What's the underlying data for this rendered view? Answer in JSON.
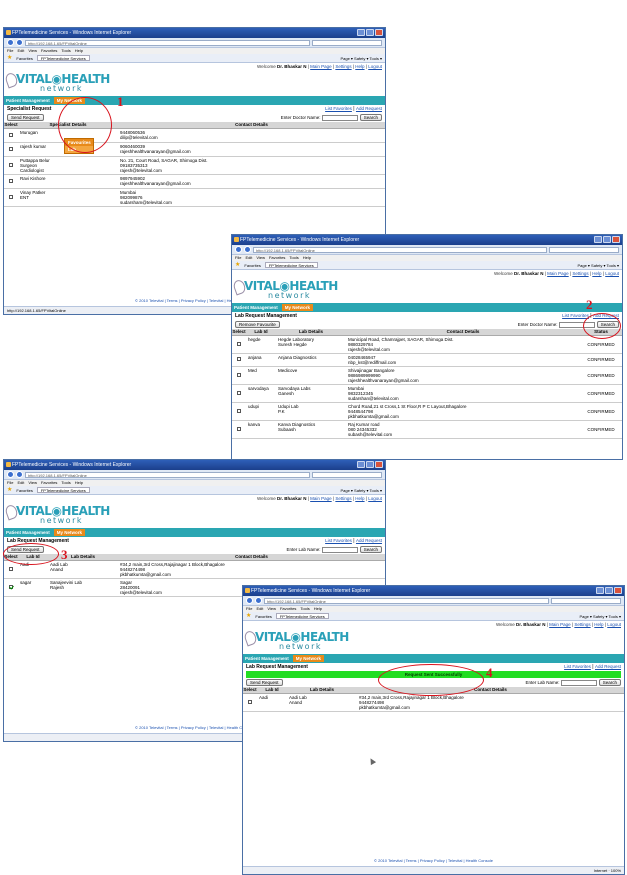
{
  "browser": {
    "title": "FPTelemedicine Services - Windows Internet Explorer",
    "url": "http://192.168.1.65/FPVitalOnline",
    "menu": [
      "File",
      "Edit",
      "View",
      "Favorites",
      "Tools",
      "Help"
    ],
    "favorites_label": "Favorites",
    "tab_label": "FPTelemedicine Services",
    "tool_right": "Page ▾  Safety ▾  Tools ▾",
    "status_url": "http://192.168.1.65/FPVitalOnline",
    "status_zone": "Internet",
    "zoom": "100%"
  },
  "site": {
    "welcome_prefix": "Welcome",
    "user": "Dr. Bhaskar N",
    "links": [
      "Main Page",
      "Settings",
      "Help",
      "Logout"
    ],
    "logo_main": "VITAL◉HEALTH",
    "logo_sub": "network",
    "nav": [
      "Patient Management",
      "My Network"
    ],
    "footer": "© 2010 Televital | Terms | Privacy Policy | Televital | Health Console",
    "list_favorites": "List Favorites",
    "sep": "|"
  },
  "annotations": [
    "1",
    "2",
    "3",
    "4"
  ],
  "win1": {
    "dropdown": [
      "Favourites",
      "Lab"
    ],
    "heading": "Specialist Request",
    "add_link": "Add Request",
    "send_button": "Send Request",
    "search_label": "Enter Doctor Name:",
    "search_button": "Search",
    "columns": [
      "Select",
      "Specialist Details",
      "Contact Details"
    ],
    "rows": [
      {
        "details": "Murugan",
        "contact": "9448060536\ndilip@televital.com"
      },
      {
        "details": "rajesh kumar",
        "contact": "9060460039\nrajeshhealthvanarayan@gmail.com"
      },
      {
        "details": "Puttappa Belur\nSurgeon\nCardiologist",
        "contact": "No. 21, Court Road, SAGAR, Shimoga Dist.\n09183735313\nrajesh@televital.com"
      },
      {
        "details": "Ravi Kishore",
        "contact": "9897945902\nrajeshhealthvanarayan@gmail.com"
      },
      {
        "details": "Vinay Patker\nENT",
        "contact": "Mumbai\n982099876\nsudarsham@televital.com"
      }
    ]
  },
  "win2": {
    "heading": "Lab Request Management",
    "remove_button": "Remove Favourite",
    "add_link": "Add Request",
    "search_label": "Enter Doctor Name:",
    "search_button": "Search",
    "columns": [
      "Select",
      "Lab Id",
      "Lab Details",
      "Contact Details",
      "Status"
    ],
    "rows": [
      {
        "id": "hegde",
        "details": "Hegde Laboratory\nSuresh Hegde",
        "contact": "Municipal Road, Chamrajpet, SAGAR, Shimoga Dist.\n9880329784\nrajesh@televital.com",
        "status": "CONFIRMED"
      },
      {
        "id": "anjana",
        "details": "Anjana Diagnostics",
        "contact": "04028465947\nnbp_kst@rediffmail.com",
        "status": "CONFIRMED"
      },
      {
        "id": "Med",
        "details": "Medicove",
        "contact": "Shivajinagar Bangalore\n9886989999990\nrajeshhealthvanarayan@gmail.com",
        "status": "CONFIRMED"
      },
      {
        "id": "sarvodaya",
        "details": "Sarvodaya Labs\nGanesh",
        "contact": "Mumbai\n9832312345\nsudarshan@televital.com",
        "status": "CONFIRMED"
      },
      {
        "id": "udupi",
        "details": "Udupi Lab\nP.K",
        "contact": "Chord Road,21 st Cross,1 St Floor,R P C Layout,Bhagalore\n9448544798\npkbhatkumta@gmail.com",
        "status": "CONFIRMED"
      },
      {
        "id": "kanva",
        "details": "Kanva Diagnostics\nSubaash",
        "contact": "Raj Kumar road\n080 24345332\nsubash@televital.com",
        "status": "CONFIRMED"
      }
    ]
  },
  "win3": {
    "heading": "Lab Request Management",
    "add_link": "Add Request",
    "send_button": "Send Request",
    "search_label": "Enter Lab Name:",
    "search_button": "Search",
    "columns": [
      "Select",
      "Lab Id",
      "Lab Details",
      "Contact Details"
    ],
    "rows": [
      {
        "id": "Aadi",
        "details": "Aadi Lab\nAnand",
        "contact": "#34,2 main,3rd Cross,Rajajinagar 1 Block,Bhagalore\n9448274498\npkbhatkumta@gmail.com",
        "checked": false
      },
      {
        "id": "sagar",
        "details": "Sanajeevini Lab\nRajesh",
        "contact": "Sagar\n28420091\nrajesh@televital.com",
        "checked": true
      }
    ]
  },
  "win4": {
    "heading": "Lab Request Management",
    "add_link": "Add Request",
    "success": "Request Sent Successfully",
    "send_button": "Send Request",
    "search_label": "Enter Lab Name:",
    "search_button": "Search",
    "columns": [
      "Select",
      "Lab Id",
      "Lab Details",
      "Contact Details"
    ],
    "rows": [
      {
        "id": "Aadi",
        "details": "Aadi Lab\nAnand",
        "contact": "#34,2 main,3rd Cross,Rajajinagar 1 Block,Bhagalore\n9448274498\npkbhatkumta@gmail.com"
      }
    ]
  }
}
